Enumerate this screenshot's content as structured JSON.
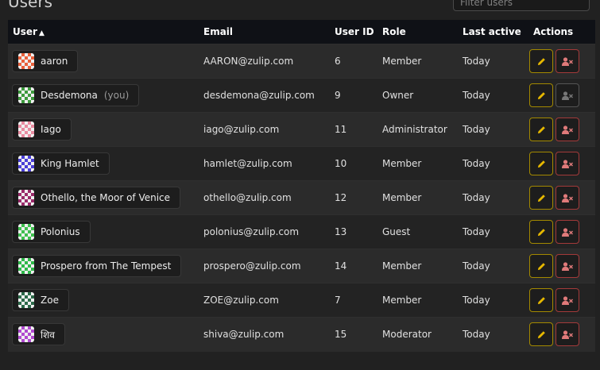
{
  "page": {
    "title": "Users"
  },
  "search": {
    "placeholder": "Filter users"
  },
  "table": {
    "headers": {
      "user": "User",
      "sort_indicator": "▲",
      "email": "Email",
      "user_id": "User ID",
      "role": "Role",
      "last_active": "Last active",
      "actions": "Actions"
    },
    "rows": [
      {
        "name": "aaron",
        "you": "",
        "email": "AARON@zulip.com",
        "id": "6",
        "role": "Member",
        "active": "Today",
        "avatar_color": "#e8613c",
        "can_deactivate": true
      },
      {
        "name": "Desdemona",
        "you": "(you)",
        "email": "desdemona@zulip.com",
        "id": "9",
        "role": "Owner",
        "active": "Today",
        "avatar_color": "#3d9a3d",
        "can_deactivate": false
      },
      {
        "name": "Iago",
        "you": "",
        "email": "iago@zulip.com",
        "id": "11",
        "role": "Administrator",
        "active": "Today",
        "avatar_color": "#e88ba0",
        "can_deactivate": true
      },
      {
        "name": "King Hamlet",
        "you": "",
        "email": "hamlet@zulip.com",
        "id": "10",
        "role": "Member",
        "active": "Today",
        "avatar_color": "#4a3fd6",
        "can_deactivate": true
      },
      {
        "name": "Othello, the Moor of Venice",
        "you": "",
        "email": "othello@zulip.com",
        "id": "12",
        "role": "Member",
        "active": "Today",
        "avatar_color": "#9a2a6a",
        "can_deactivate": true
      },
      {
        "name": "Polonius",
        "you": "",
        "email": "polonius@zulip.com",
        "id": "13",
        "role": "Guest",
        "active": "Today",
        "avatar_color": "#3fc04f",
        "can_deactivate": true
      },
      {
        "name": "Prospero from The Tempest",
        "you": "",
        "email": "prospero@zulip.com",
        "id": "14",
        "role": "Member",
        "active": "Today",
        "avatar_color": "#2fb84a",
        "can_deactivate": true
      },
      {
        "name": "Zoe",
        "you": "",
        "email": "ZOE@zulip.com",
        "id": "7",
        "role": "Member",
        "active": "Today",
        "avatar_color": "#2d6a4a",
        "can_deactivate": true
      },
      {
        "name": "शिव",
        "you": "",
        "email": "shiva@zulip.com",
        "id": "15",
        "role": "Moderator",
        "active": "Today",
        "avatar_color": "#b04ad0",
        "can_deactivate": true
      }
    ]
  },
  "icons": {
    "edit": "pencil-icon",
    "deactivate": "user-times-icon"
  },
  "colors": {
    "edit_border": "#a38900",
    "deactivate_border": "#a33a3a",
    "header_bg": "#0f1116"
  }
}
